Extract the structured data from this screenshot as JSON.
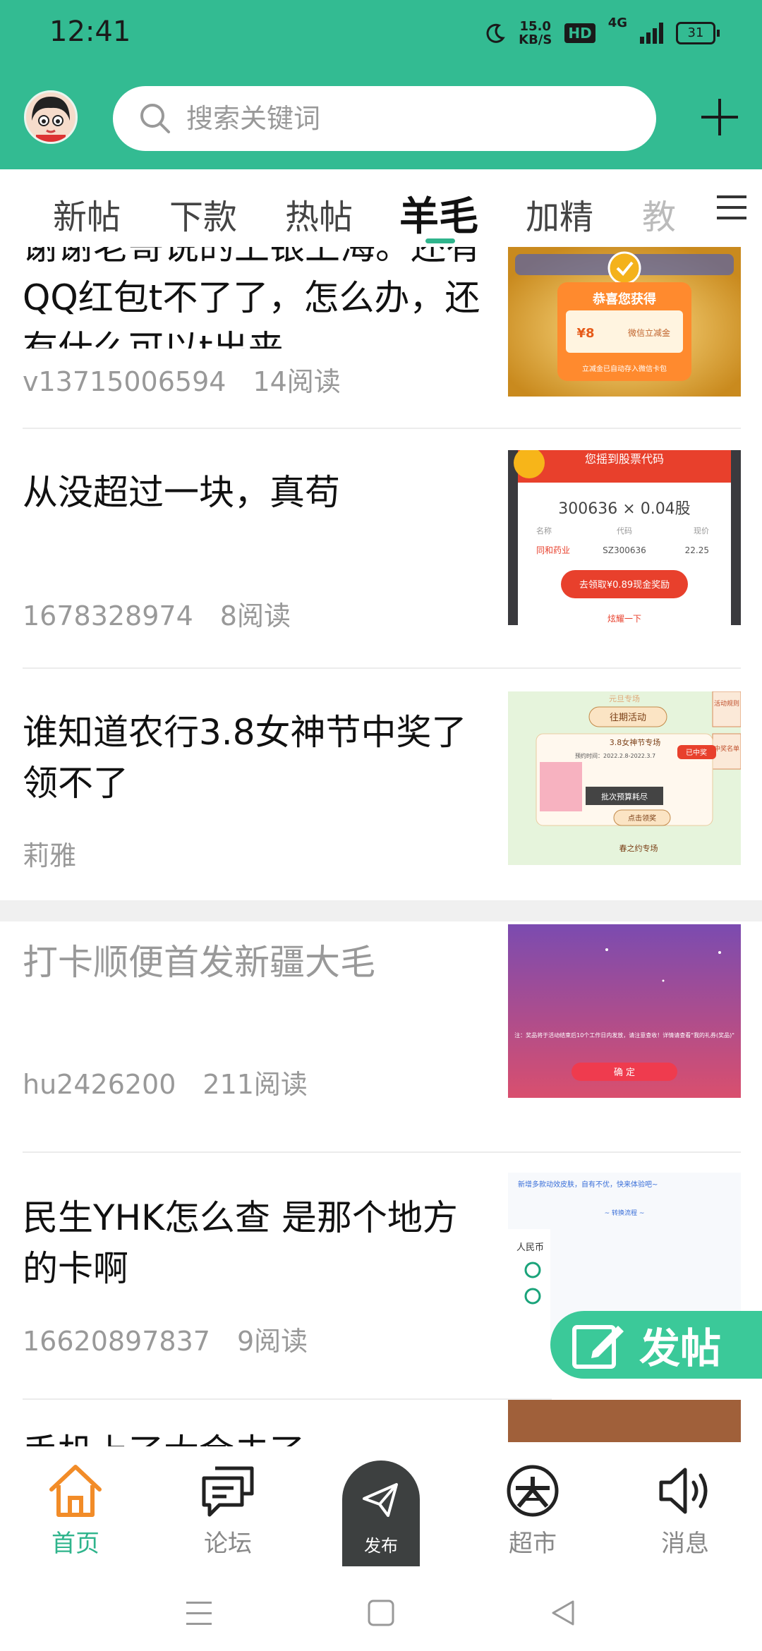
{
  "status_bar": {
    "time": "12:41",
    "net_speed_value": "15.0",
    "net_speed_unit": "KB/S",
    "hd": "HD",
    "network": "4G",
    "battery": "31"
  },
  "header": {
    "search_placeholder": "搜索关键词",
    "accent_color": "#33bb92"
  },
  "tabs": [
    {
      "label": "新帖",
      "active": false
    },
    {
      "label": "下款",
      "active": false
    },
    {
      "label": "热帖",
      "active": false
    },
    {
      "label": "羊毛",
      "active": true
    },
    {
      "label": "加精",
      "active": false
    },
    {
      "label": "教",
      "active": false
    }
  ],
  "feed": {
    "items": [
      {
        "title": "谢谢老哥说的上银上海。还有QQ红包t不了了，怎么办，还有什么可以t出来",
        "author": "v13715006594",
        "reads": "14阅读",
        "thumb": {
          "headline": "恭喜您获得",
          "amount": "¥8",
          "prize": "微信立减金",
          "note": "立减金已自动存入微信卡包"
        }
      },
      {
        "title": "从没超过一块，真苟",
        "author": "1678328974",
        "reads": "8阅读",
        "thumb": {
          "header": "您摇到股票代码",
          "main": "300636 × 0.04股",
          "col1": "名称",
          "col2": "代码",
          "col3": "现价",
          "name": "同和药业",
          "code": "SZ300636",
          "price": "22.25",
          "button": "去领取¥0.89现金奖励",
          "footer": "炫耀一下"
        }
      },
      {
        "title": "谁知道农行3.8女神节中奖了领不了",
        "author": "莉雅",
        "reads": "",
        "thumb": {
          "top": "元旦专场",
          "tab": "往期活动",
          "event": "3.8女神节专场",
          "time": "预约时间：2022.2.8-2022.3.7",
          "status": "已中奖",
          "toast": "批次预算耗尽",
          "button": "点击领奖",
          "bottom": "春之约专场",
          "side1": "活动规则",
          "side2": "中奖名单"
        }
      },
      {
        "title": "打卡顺便首发新疆大毛",
        "author": "hu2426200",
        "reads": "211阅读",
        "thumb": {
          "note": "注：奖品将于活动结束后10个工作日内发放，请注意查收！详情请查看\"我的礼券(奖品)\"",
          "button": "确 定"
        }
      },
      {
        "title": "民生YHK怎么查 是那个地方的卡啊",
        "author": "16620897837",
        "reads": "9阅读",
        "thumb": {
          "banner": "新增多款动效皮肤，自有不优，快来体验吧~",
          "link": "~ 转换流程 ~",
          "label": "人民币"
        }
      },
      {
        "title": "手机上了大金去了",
        "author": "",
        "reads": ""
      }
    ]
  },
  "fab": {
    "label": "发帖"
  },
  "bottom_nav": [
    {
      "label": "首页",
      "icon": "home-icon",
      "active": true
    },
    {
      "label": "论坛",
      "icon": "chat-icon",
      "active": false
    },
    {
      "label": "发布",
      "icon": "send-icon",
      "active": false
    },
    {
      "label": "超市",
      "icon": "market-icon",
      "active": false
    },
    {
      "label": "消息",
      "icon": "speaker-icon",
      "active": false
    }
  ]
}
